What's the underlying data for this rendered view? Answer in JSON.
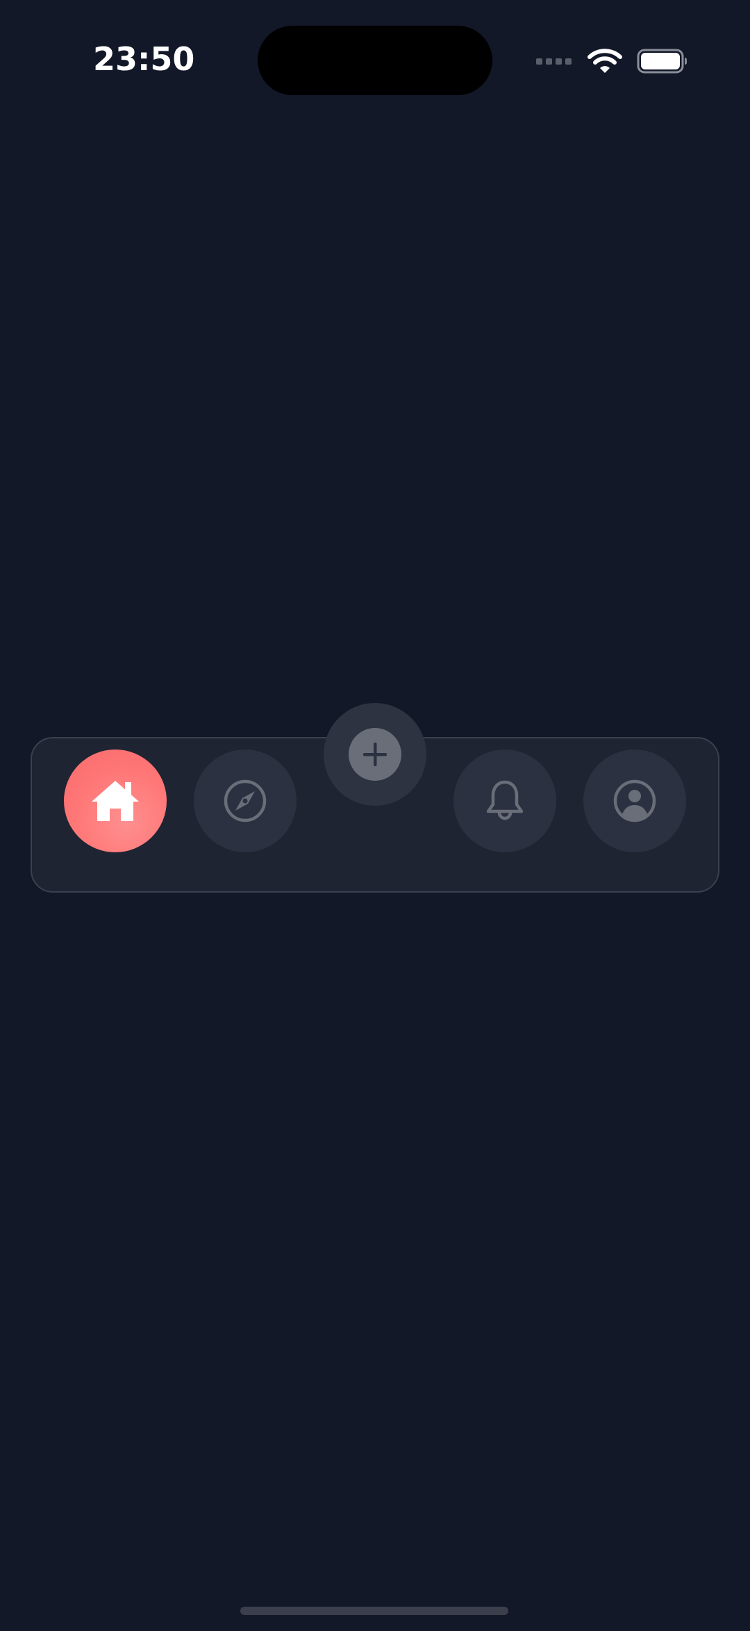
{
  "status_bar": {
    "time": "23:50",
    "icons": [
      "cellular-signal-icon",
      "wifi-icon",
      "battery-icon"
    ]
  },
  "tab_bar": {
    "active_tab": "home",
    "tabs": [
      {
        "id": "home",
        "icon": "home-icon",
        "active": true
      },
      {
        "id": "explore",
        "icon": "compass-icon",
        "active": false
      },
      {
        "id": "notifications",
        "icon": "bell-icon",
        "active": false
      },
      {
        "id": "profile",
        "icon": "user-circle-icon",
        "active": false
      }
    ],
    "center_action": {
      "icon": "plus-icon"
    }
  },
  "colors": {
    "background": "#121828",
    "tab_bar": "#1e2432",
    "tab_button": "#2b3140",
    "active_accent": "#ff7676",
    "inactive_icon": "#6a6e79"
  }
}
